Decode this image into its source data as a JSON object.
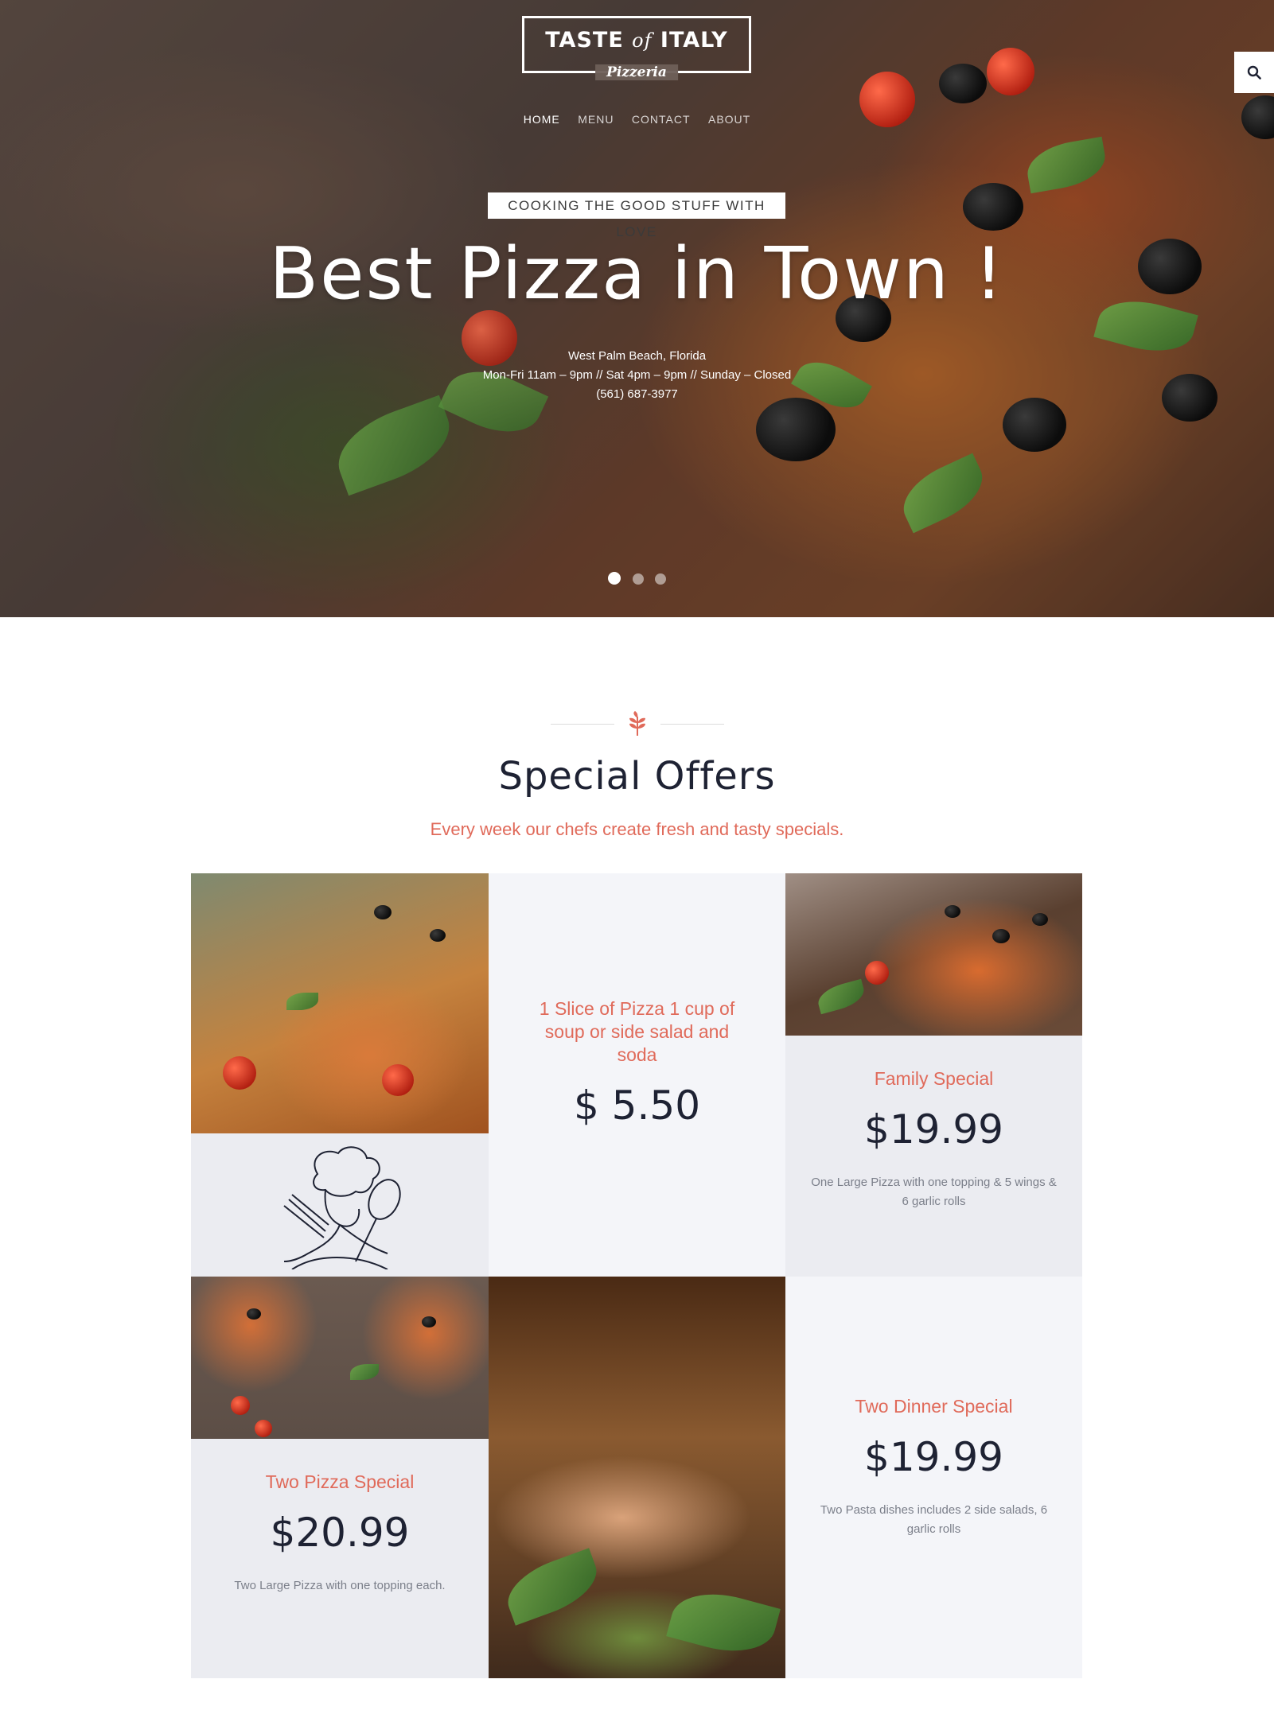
{
  "logo": {
    "title_part1": "TASTE",
    "title_part2": "of",
    "title_part3": "ITALY",
    "subtitle": "Pizzeria"
  },
  "nav": {
    "items": [
      {
        "label": "HOME"
      },
      {
        "label": "MENU"
      },
      {
        "label": "CONTACT"
      },
      {
        "label": "ABOUT"
      }
    ]
  },
  "search": {
    "icon": "search-icon"
  },
  "hero": {
    "tagline": "COOKING THE GOOD STUFF WITH LOVE",
    "title": "Best Pizza in Town !",
    "location": "West Palm Beach, Florida",
    "hours": "Mon-Fri 11am – 9pm // Sat 4pm – 9pm // Sunday – Closed",
    "phone": "(561) 687-3977",
    "slides": 3,
    "active_slide": 1
  },
  "offers_section": {
    "title": "Special Offers",
    "subtitle": "Every week our chefs create fresh and tasty specials.",
    "icon": "leaf-icon"
  },
  "offers": [
    {
      "name": "1 Slice of Pizza 1 cup of soup or side salad and soda",
      "price": "$ 5.50",
      "description": ""
    },
    {
      "name": "Family Special",
      "price": "$19.99",
      "description": "One Large Pizza with one topping & 5 wings & 6 garlic rolls"
    },
    {
      "name": "Two Pizza Special",
      "price": "$20.99",
      "description": "Two Large Pizza with one topping each."
    },
    {
      "name": "Two Dinner Special",
      "price": "$19.99",
      "description": "Two Pasta dishes includes 2 side salads, 6 garlic rolls"
    }
  ],
  "colors": {
    "accent": "#e06a5a",
    "dark": "#1e2233",
    "cell_light": "#f4f5f9",
    "cell_mid": "#ebecf1"
  }
}
